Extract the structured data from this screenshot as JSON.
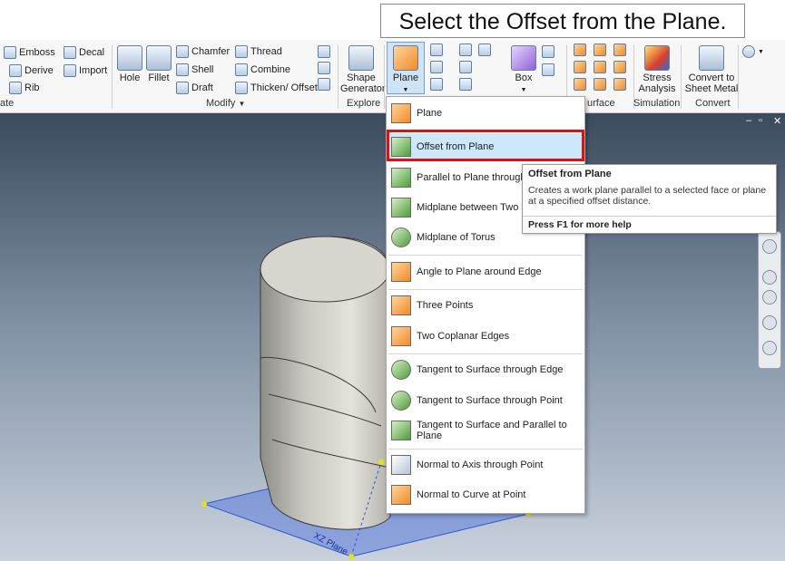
{
  "instruction": "Select the Offset from the Plane.",
  "ribbon": {
    "create_partial_label": "ate",
    "buttons": {
      "emboss": "Emboss",
      "decal": "Decal",
      "derive": "Derive",
      "import": "Import",
      "rib": "Rib",
      "hole": "Hole",
      "fillet": "Fillet",
      "chamfer": "Chamfer",
      "thread": "Thread",
      "shell": "Shell",
      "combine": "Combine",
      "draft": "Draft",
      "thicken_offset": "Thicken/ Offset",
      "shape_generator_line1": "Shape",
      "shape_generator_line2": "Generator",
      "plane": "Plane",
      "box": "Box",
      "stress_line1": "Stress",
      "stress_line2": "Analysis",
      "convert_line1": "Convert to",
      "convert_line2": "Sheet Metal"
    },
    "panels": {
      "modify": "Modify",
      "modify_arrow": "▼",
      "explore": "Explore",
      "surface_partial": "urface",
      "simulation": "Simulation",
      "convert": "Convert"
    }
  },
  "plane_menu": {
    "items": [
      {
        "label": "Plane"
      },
      {
        "label": "Offset from Plane"
      },
      {
        "label": "Parallel to Plane through"
      },
      {
        "label": "Midplane between Two Pl"
      },
      {
        "label": "Midplane of Torus"
      },
      {
        "label": "Angle to Plane around Edge"
      },
      {
        "label": "Three Points"
      },
      {
        "label": "Two Coplanar Edges"
      },
      {
        "label": "Tangent to Surface through Edge"
      },
      {
        "label": "Tangent to Surface through Point"
      },
      {
        "label": "Tangent to Surface and Parallel to Plane"
      },
      {
        "label": "Normal to Axis through Point"
      },
      {
        "label": "Normal to Curve at Point"
      }
    ]
  },
  "tooltip": {
    "title": "Offset from Plane",
    "description": "Creates a work plane parallel to a selected face or plane at a specified offset distance.",
    "help": "Press F1 for more help"
  },
  "viewport": {
    "plane_label": "XZ Plane",
    "window_controls": [
      "–",
      "▫",
      "✕"
    ]
  },
  "colors": {
    "highlight_border": "#e01010",
    "selected_item": "#cde8fa",
    "work_plane": "#4a6fe0"
  }
}
